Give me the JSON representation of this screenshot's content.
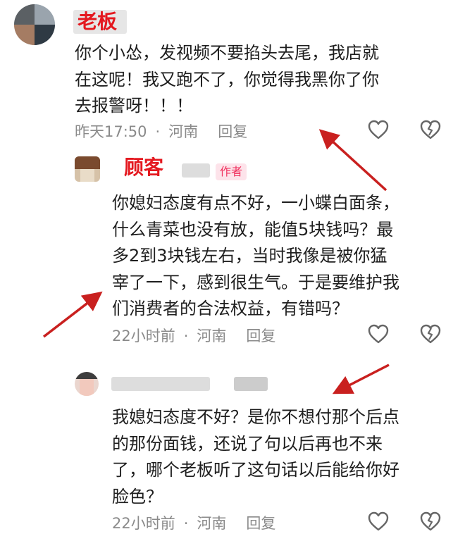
{
  "comments": [
    {
      "username_label": "老板",
      "text_lines": [
        "你个小怂，发视频不要掐头去尾，我店就",
        "在这呢！我又跑不了，你觉得我黑你了你",
        "去报警呀！！！"
      ],
      "time": "昨天17:50",
      "location": "河南",
      "reply_label": "回复"
    },
    {
      "username_label": "顾客",
      "badge": "作者",
      "text_lines": [
        "你媳妇态度有点不好，一小蝶白面条，",
        "什么青菜也没有放，能值5块钱吗？最",
        "多2到3块钱左右，当时我像是被你猛",
        "宰了一下，感到很生气。于是要维护我",
        "们消费者的合法权益，有错吗？"
      ],
      "time": "22小时前",
      "location": "河南",
      "reply_label": "回复"
    },
    {
      "text_lines": [
        "我媳妇态度不好？是你不想付那个后点",
        "的那份面钱，还说了句以后再也不来",
        "了，哪个老板听了这句话以后能给你好",
        "脸色？"
      ],
      "time": "22小时前",
      "location": "河南",
      "reply_label": "回复"
    }
  ],
  "meta_separator": "·",
  "icons": {
    "like": "heart-outline-icon",
    "dislike": "broken-heart-icon"
  },
  "colors": {
    "label_red": "#e4181f",
    "arrow_red": "#c9201f",
    "meta_gray": "#8a8a8a",
    "badge_bg": "#fde3ea",
    "badge_text": "#f0305d"
  }
}
